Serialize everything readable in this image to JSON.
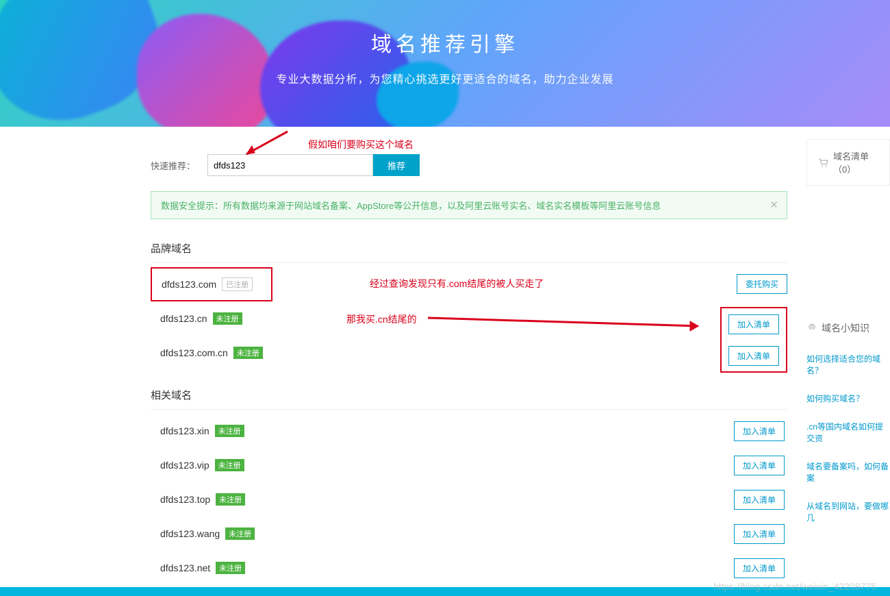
{
  "banner": {
    "title": "域名推荐引擎",
    "subtitle": "专业大数据分析，为您精心挑选更好更适合的域名，助力企业发展"
  },
  "search": {
    "label": "快速推荐：",
    "value": "dfds123",
    "button": "推荐"
  },
  "tip": {
    "text": "数据安全提示：所有数据均来源于网站域名备案、AppStore等公开信息，以及阿里云账号实名、域名实名模板等阿里云账号信息"
  },
  "annotations": {
    "a1": "假如咱们要购买这个域名",
    "a2": "经过查询发现只有.com结尾的被人买走了",
    "a3": "那我买.cn结尾的"
  },
  "badges": {
    "registered": "已注册",
    "unregistered": "未注册"
  },
  "actions": {
    "entrust": "委托购买",
    "add": "加入清单"
  },
  "sections": {
    "brand": "品牌域名",
    "related": "相关域名"
  },
  "brand_domains": [
    {
      "name": "dfds123.com",
      "registered": true,
      "action": "entrust"
    },
    {
      "name": "dfds123.cn",
      "registered": false,
      "action": "add"
    },
    {
      "name": "dfds123.com.cn",
      "registered": false,
      "action": "add"
    }
  ],
  "related_domains": [
    {
      "name": "dfds123.xin",
      "registered": false
    },
    {
      "name": "dfds123.vip",
      "registered": false
    },
    {
      "name": "dfds123.top",
      "registered": false
    },
    {
      "name": "dfds123.wang",
      "registered": false
    },
    {
      "name": "dfds123.net",
      "registered": false
    }
  ],
  "aside": {
    "cart_title": "域名清单（0）",
    "tips_title": "域名小知识",
    "tips": [
      "如何选择适合您的域名？",
      "如何购买域名？",
      ".cn等国内域名如何提交资",
      "域名要备案吗，如何备案",
      "从域名到网站，要做哪几"
    ]
  },
  "watermark": "https://blog.csdn.net/weixin_42208775"
}
